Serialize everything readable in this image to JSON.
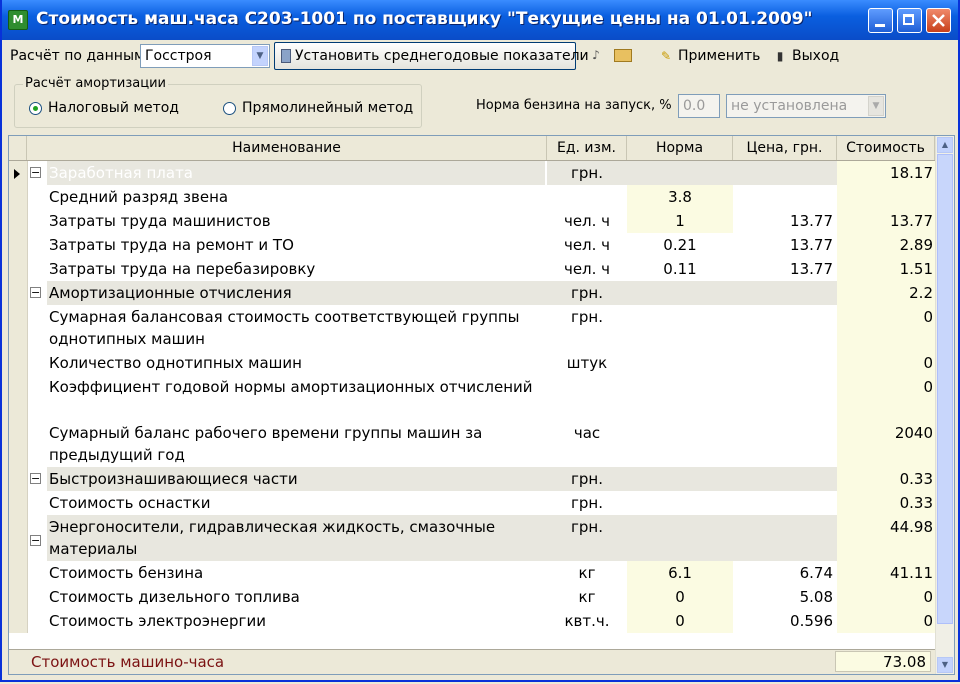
{
  "window": {
    "title": "Стоимость маш.часа  С203-1001  по поставщику \"Текущие цены на 01.01.2009\"",
    "icons": {
      "app": "calculator-app-icon",
      "minimize": "minimize-icon",
      "maximize": "maximize-icon",
      "close": "close-icon"
    }
  },
  "toolbar": {
    "calc_by_label": "Расчёт по данным",
    "source_value": "Госстроя",
    "set_average_label": "Установить среднегодовые показатели",
    "apply_label": "Применить",
    "exit_label": "Выход"
  },
  "amortization": {
    "caption": "Расчёт амортизации",
    "method_tax": "Налоговый метод",
    "method_linear": "Прямолинейный метод",
    "selected": "tax"
  },
  "fuel": {
    "label": "Норма бензина на запуск, %",
    "value": "0.0",
    "select_value": "не установлена"
  },
  "table": {
    "headers": {
      "name": "Наименование",
      "unit": "Ед. изм.",
      "norm": "Норма",
      "price": "Цена, грн.",
      "cost": "Стоимость"
    },
    "rows": [
      {
        "type": "group",
        "name": "Заработная плата",
        "unit": "грн.",
        "norm": "",
        "price": "",
        "cost": "18.17",
        "selected": true
      },
      {
        "type": "item",
        "name": "Средний разряд звена",
        "unit": "",
        "norm": "3.8",
        "price": "",
        "cost": "",
        "norm_hl": true
      },
      {
        "type": "item",
        "name": "Затраты труда машинистов",
        "unit": "чел. ч",
        "norm": "1",
        "price": "13.77",
        "cost": "13.77",
        "norm_hl": true
      },
      {
        "type": "item",
        "name": "Затраты труда на ремонт и ТО",
        "unit": "чел. ч",
        "norm": "0.21",
        "price": "13.77",
        "cost": "2.89"
      },
      {
        "type": "item",
        "name": "Затраты труда на перебазировку",
        "unit": "чел. ч",
        "norm": "0.11",
        "price": "13.77",
        "cost": "1.51"
      },
      {
        "type": "group",
        "name": "Амортизационные отчисления",
        "unit": "грн.",
        "norm": "",
        "price": "",
        "cost": "2.2"
      },
      {
        "type": "item",
        "name": "Сумарная балансовая стоимость соответствующей группы однотипных машин",
        "unit": "грн.",
        "norm": "",
        "price": "",
        "cost": "0",
        "lines": 2
      },
      {
        "type": "item",
        "name": "Количество однотипных машин",
        "unit": "штук",
        "norm": "",
        "price": "",
        "cost": "0"
      },
      {
        "type": "item",
        "name": "Коэффициент годовой нормы амортизационных отчислений",
        "unit": "",
        "norm": "",
        "price": "",
        "cost": "0",
        "lines": 2
      },
      {
        "type": "item",
        "name": "Сумарный баланс рабочего времени группы машин за предыдущий год",
        "unit": "час",
        "norm": "",
        "price": "",
        "cost": "2040",
        "lines": 2
      },
      {
        "type": "group",
        "name": "Быстроизнашивающиеся части",
        "unit": "грн.",
        "norm": "",
        "price": "",
        "cost": "0.33"
      },
      {
        "type": "item",
        "name": "Стоимость оснастки",
        "unit": "грн.",
        "norm": "",
        "price": "",
        "cost": "0.33"
      },
      {
        "type": "group",
        "name": "Энергоносители, гидравлическая жидкость, смазочные материалы",
        "unit": "грн.",
        "norm": "",
        "price": "",
        "cost": "44.98",
        "lines": 2
      },
      {
        "type": "item",
        "name": "Стоимость бензина",
        "unit": "кг",
        "norm": "6.1",
        "price": "6.74",
        "cost": "41.11",
        "norm_hl": true
      },
      {
        "type": "item",
        "name": "Стоимость дизельного топлива",
        "unit": "кг",
        "norm": "0",
        "price": "5.08",
        "cost": "0",
        "norm_hl": true
      },
      {
        "type": "item",
        "name": "Стоимость электроэнергии",
        "unit": "квт.ч.",
        "norm": "0",
        "price": "0.596",
        "cost": "0",
        "norm_hl": true
      }
    ],
    "footer_label": "Стоимость машино-часа",
    "footer_total": "73.08"
  }
}
